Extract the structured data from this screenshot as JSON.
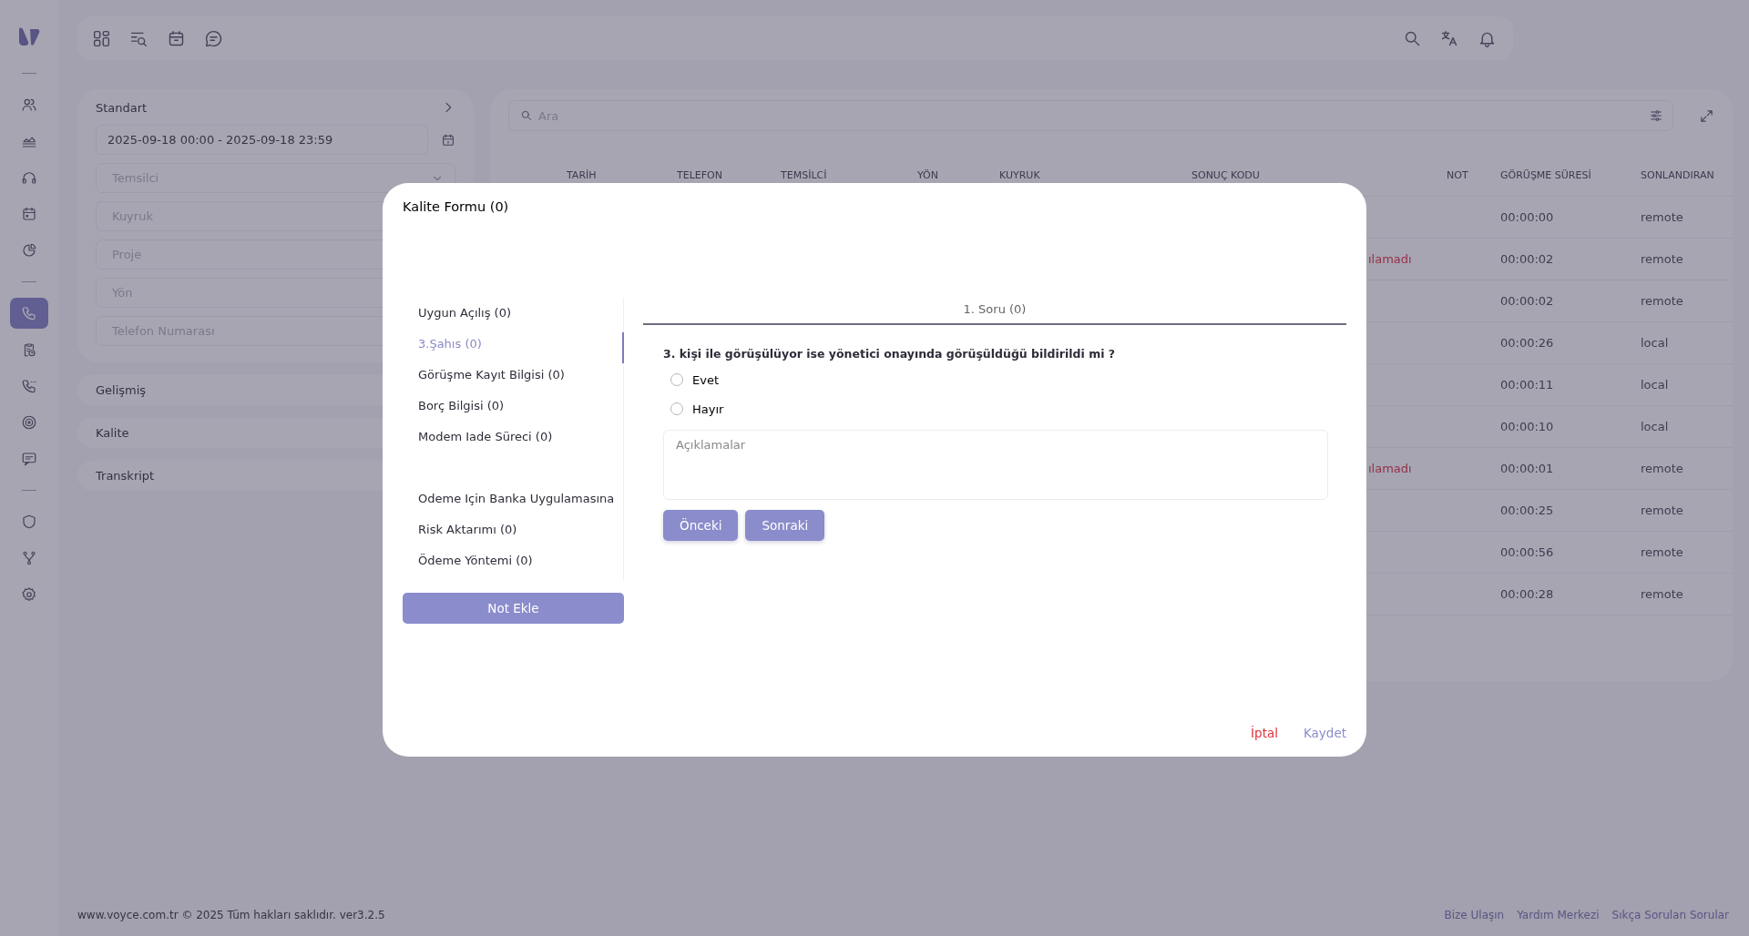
{
  "sidebar": {
    "items": [
      {
        "selected": false
      },
      {
        "selected": false
      },
      {
        "selected": false
      },
      {
        "selected": false
      },
      {
        "selected": false
      },
      {
        "selected": true
      },
      {
        "selected": false
      },
      {
        "selected": false
      },
      {
        "selected": false
      },
      {
        "selected": false
      },
      {
        "selected": false
      },
      {
        "selected": false
      },
      {
        "selected": false
      }
    ]
  },
  "filters": {
    "title": "Standart",
    "date_range": "2025-09-18 00:00 - 2025-09-18 23:59",
    "fields": [
      {
        "kind": "select",
        "placeholder": "Temsilci"
      },
      {
        "kind": "text",
        "placeholder": "Kuyruk"
      },
      {
        "kind": "text",
        "placeholder": "Proje"
      },
      {
        "kind": "text",
        "placeholder": "Yön"
      },
      {
        "kind": "text",
        "placeholder": "Telefon Numarası"
      }
    ],
    "sections": [
      "Gelişmiş",
      "Kalite",
      "Transkript"
    ]
  },
  "search": {
    "placeholder": "Ara"
  },
  "table": {
    "columns": [
      "TARİH",
      "TELEFON",
      "TEMSİLCİ",
      "YÖN",
      "KUYRUK",
      "SONUÇ KODU",
      "NOT",
      "GÖRÜŞME SÜRESİ",
      "SONLANDIRAN"
    ],
    "rows": [
      {
        "gorusme_suresi": "00:00:00",
        "sonlandiran": "remote"
      },
      {
        "sonuc_kodu": "ılamadı",
        "gorusme_suresi": "00:00:02",
        "sonlandiran": "remote"
      },
      {
        "gorusme_suresi": "00:00:02",
        "sonlandiran": "remote"
      },
      {
        "gorusme_suresi": "00:00:26",
        "sonlandiran": "local"
      },
      {
        "gorusme_suresi": "00:00:11",
        "sonlandiran": "local"
      },
      {
        "gorusme_suresi": "00:00:10",
        "sonlandiran": "local"
      },
      {
        "sonuc_kodu": "ılamadı",
        "gorusme_suresi": "00:00:01",
        "sonlandiran": "remote"
      },
      {
        "gorusme_suresi": "00:00:25",
        "sonlandiran": "remote"
      },
      {
        "gorusme_suresi": "00:00:56",
        "sonlandiran": "remote"
      },
      {
        "gorusme_suresi": "00:00:28",
        "sonlandiran": "remote"
      }
    ]
  },
  "modal": {
    "title": "Kalite Formu (0)",
    "categories": [
      {
        "label": "Uygun Açılış (0)",
        "selected": false
      },
      {
        "label": "3.Şahıs (0)",
        "selected": true
      },
      {
        "label": "Görüşme Kayıt Bilgisi (0)",
        "selected": false
      },
      {
        "label": "Borç Bilgisi (0)",
        "selected": false
      },
      {
        "label": "Modem Iade Süreci (0)",
        "selected": false
      },
      {
        "label": "Odeme Için Banka Uygulamasına",
        "selected": false
      },
      {
        "label": "Risk Aktarımı (0)",
        "selected": false
      },
      {
        "label": "Ödeme Yöntemi (0)",
        "selected": false
      }
    ],
    "add_note_button": "Not Ekle",
    "tabs": [
      {
        "label": "1. Soru (0)",
        "selected": true
      }
    ],
    "question": "3. kişi ile görüşülüyor ise yönetici onayında görüşüldüğü bildirildi mi ?",
    "options": [
      {
        "label": "Evet",
        "checked": false
      },
      {
        "label": "Hayır",
        "checked": false
      }
    ],
    "comment": {
      "placeholder": "Açıklamalar"
    },
    "nav_buttons": [
      "Önceki",
      "Sonraki"
    ],
    "cancel": "İptal",
    "save": "Kaydet"
  },
  "footer": {
    "copyright": "www.voyce.com.tr © 2025 Tüm hakları saklıdır. ver3.2.5",
    "links": [
      "Bize Ulaşın",
      "Yardım Merkezi",
      "Sıkça Sorulan Sorular"
    ]
  }
}
